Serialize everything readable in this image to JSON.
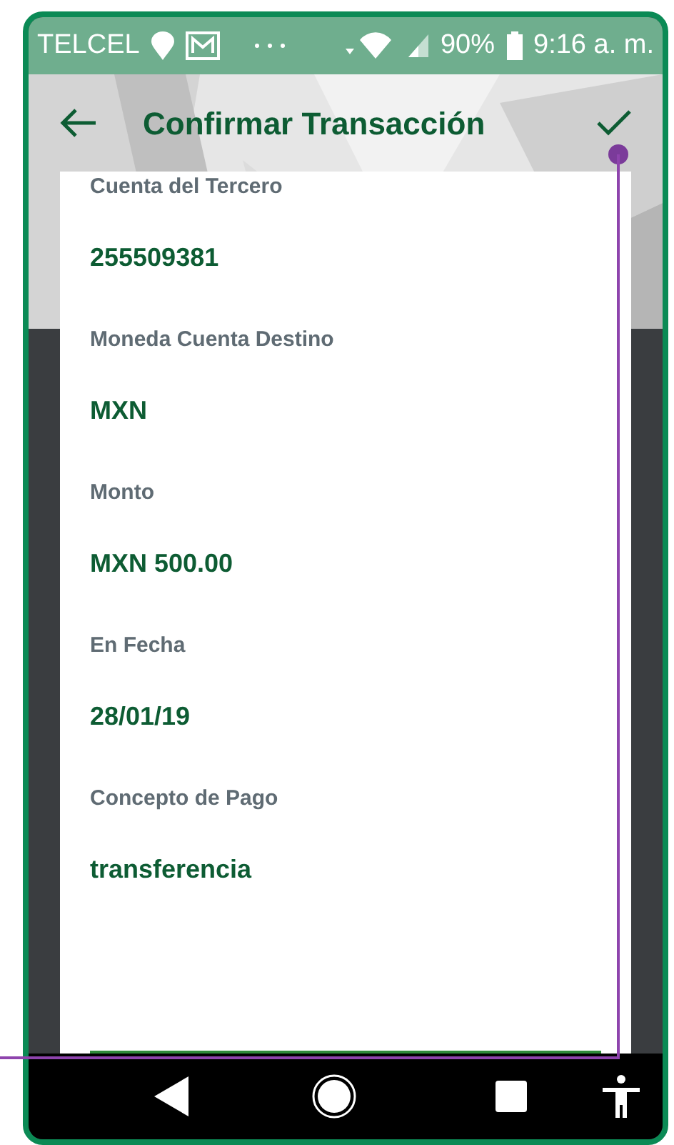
{
  "status_bar": {
    "carrier": "TELCEL",
    "battery": "90%",
    "time": "9:16 a. m."
  },
  "header": {
    "title": "Confirmar Transacción"
  },
  "fields": [
    {
      "label": "Cuenta del Tercero",
      "value": "255509381"
    },
    {
      "label": "Moneda Cuenta Destino",
      "value": "MXN"
    },
    {
      "label": "Monto",
      "value": "MXN 500.00"
    },
    {
      "label": "En Fecha",
      "value": "28/01/19"
    },
    {
      "label": "Concepto de Pago",
      "value": "transferencia"
    }
  ]
}
